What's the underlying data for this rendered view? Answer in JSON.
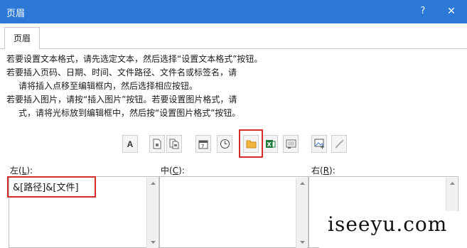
{
  "window": {
    "title": "页眉",
    "help_label": "?",
    "close_label": "✕"
  },
  "tabs": [
    {
      "label": "页眉",
      "active": true
    }
  ],
  "instructions": [
    "若要设置文本格式，请先选定文本，然后选择“设置文本格式”按钮。",
    "若要插入页码、日期、时间、文件路径、文件名或标签名，请",
    "请将插入点移至编辑框内，然后选择相应按钮。",
    "若要插入图片，请按“插入图片”按钮。若要设置图片格式，请",
    "式，请将光标放到编辑框中，然后按“设置图片格式”按钮。"
  ],
  "toolbar": {
    "format_text_label": "A",
    "buttons": [
      "format-text-icon",
      "page-number-icon",
      "page-count-icon",
      "date-icon",
      "time-icon",
      "file-path-icon",
      "file-name-icon",
      "sheet-name-icon",
      "insert-picture-icon",
      "format-picture-icon"
    ],
    "highlighted": "file-path-icon",
    "accent_color": "#d42b2b"
  },
  "sections": {
    "left": {
      "label": "左(",
      "hotkey": "L",
      "suffix": "):",
      "value": "&[路径]&[文件]"
    },
    "center": {
      "label": "中(",
      "hotkey": "C",
      "suffix": "):",
      "value": ""
    },
    "right": {
      "label": "右(",
      "hotkey": "R",
      "suffix": "):",
      "value": ""
    }
  },
  "watermark": "iseeyu.com",
  "colors": {
    "titlebar": "#2b78d6",
    "highlight": "#d42b2b"
  }
}
